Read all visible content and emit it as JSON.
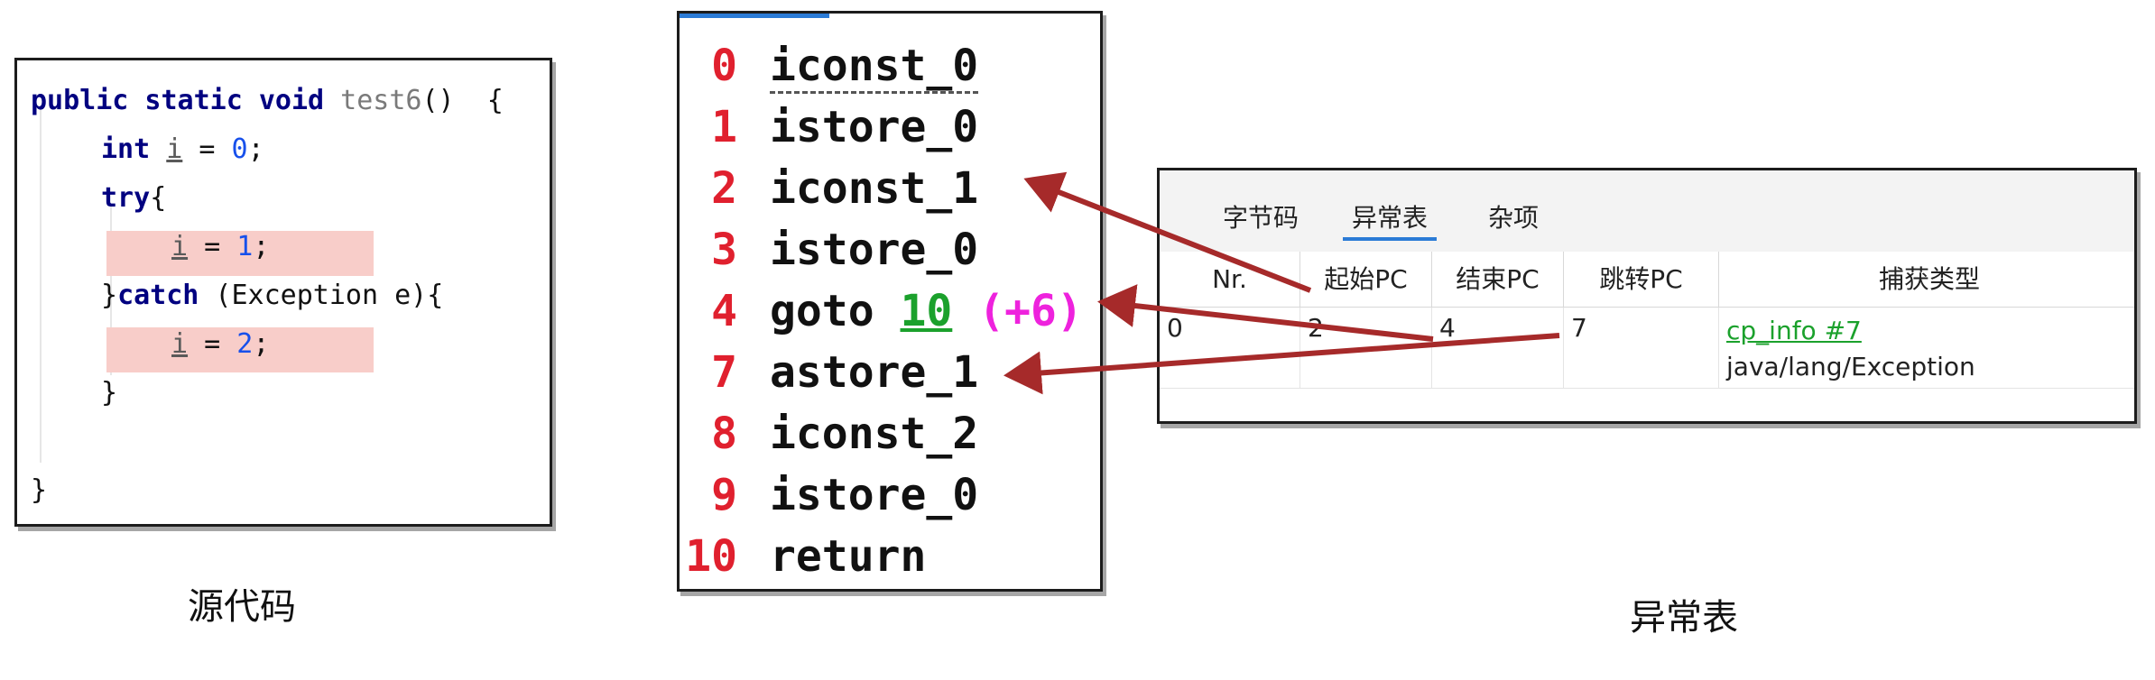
{
  "source": {
    "caption": "源代码",
    "lines": {
      "l1_kw": "public static void ",
      "l1_method": "test6",
      "l1_tail": "()  {",
      "l2_kw": "int ",
      "l2_var": "i",
      "l2_eq": " = ",
      "l2_num": "0",
      "l2_end": ";",
      "l3_kw": "try",
      "l3_end": "{",
      "l4_var": "i",
      "l4_eq": " = ",
      "l4_num": "1",
      "l4_end": ";",
      "l5_a": "}",
      "l5_kw": "catch",
      "l5_b": " (Exception e){",
      "l6_var": "i",
      "l6_eq": " = ",
      "l6_num": "2",
      "l6_end": ";",
      "l7": "}",
      "l8": "}"
    }
  },
  "bytecode": {
    "rows": [
      {
        "idx": "0",
        "op": "iconst_0"
      },
      {
        "idx": "1",
        "op": "istore_0"
      },
      {
        "idx": "2",
        "op": "iconst_1"
      },
      {
        "idx": "3",
        "op": "istore_0"
      },
      {
        "idx": "4",
        "op": "goto ",
        "target": "10",
        "offset": " (+6)"
      },
      {
        "idx": "7",
        "op": "astore_1"
      },
      {
        "idx": "8",
        "op": "iconst_2"
      },
      {
        "idx": "9",
        "op": "istore_0"
      },
      {
        "idx": "10",
        "op": "return"
      }
    ]
  },
  "exception_table": {
    "caption": "异常表",
    "tabs": [
      "字节码",
      "异常表",
      "杂项"
    ],
    "active_tab": "异常表",
    "headers": [
      "Nr.",
      "起始PC",
      "结束PC",
      "跳转PC",
      "捕获类型"
    ],
    "row": {
      "nr": "0",
      "start_pc": "2",
      "end_pc": "4",
      "handler_pc": "7",
      "catch_link": "cp_info #7",
      "catch_type": "java/lang/Exception"
    }
  },
  "colors": {
    "arrow": "#a62a2a",
    "index": "#e0202e",
    "jump_target": "#1ba12c",
    "offset": "#ee22dd",
    "highlight": "#f8cdc9",
    "tab_accent": "#2b7bd6"
  }
}
